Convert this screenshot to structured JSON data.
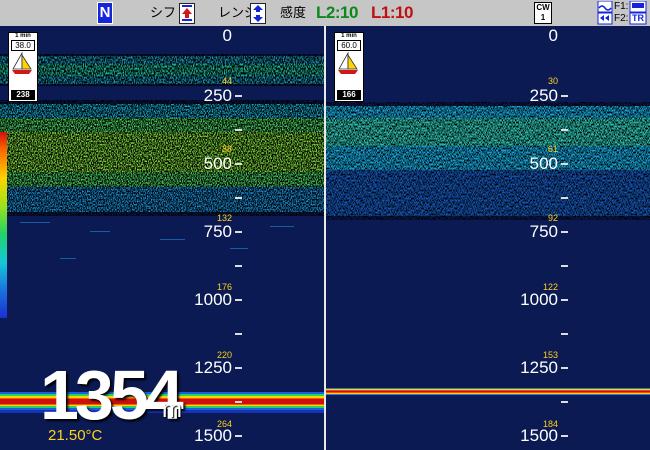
{
  "header": {
    "mode_badge": "N",
    "shift_label": "シフト:",
    "range_label": "レンジ:",
    "gain_label": "感度",
    "l2_value": "L2:10",
    "l1_value": "L1:10",
    "cw_top": "CW",
    "cw_bottom": "1",
    "f1_label": "F1:",
    "f2_label": "F2:",
    "tr_label": "TR"
  },
  "left_panel": {
    "gauge_label": "1 min",
    "gauge_value": "38.0",
    "gauge_bottom": "238",
    "depth_labels": [
      "0",
      "250",
      "500",
      "750",
      "1000",
      "1250",
      "1500"
    ],
    "minor_labels": [
      "44",
      "88",
      "132",
      "176",
      "220",
      "264"
    ],
    "bottom_depth": "1354",
    "bottom_unit": "m",
    "temperature": "21.50°C"
  },
  "right_panel": {
    "gauge_label": "1 min",
    "gauge_value": "60.0",
    "gauge_bottom": "166",
    "depth_labels": [
      "0",
      "250",
      "500",
      "750",
      "1000",
      "1250",
      "1500"
    ],
    "minor_labels": [
      "30",
      "61",
      "92",
      "122",
      "153",
      "184"
    ]
  },
  "colors": {
    "background": "#0b1a52",
    "depth_text": "#ffffff",
    "minor_text": "#ffd21a",
    "l2_color": "#0a8a1a",
    "l1_color": "#c01010"
  }
}
